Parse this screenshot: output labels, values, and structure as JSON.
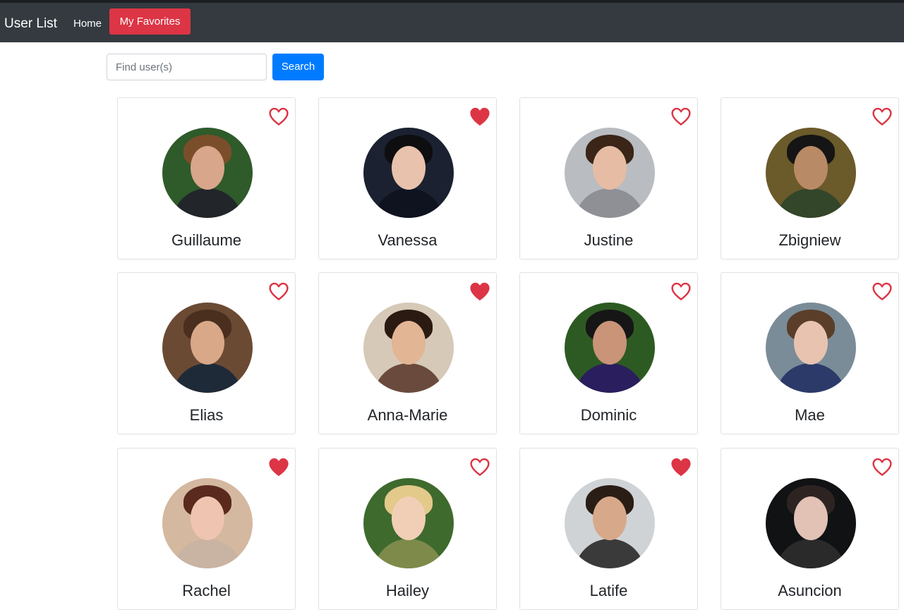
{
  "navbar": {
    "brand": "User List",
    "home_label": "Home",
    "favorites_label": "My Favorites"
  },
  "search": {
    "placeholder": "Find user(s)",
    "value": "",
    "button_label": "Search"
  },
  "colors": {
    "heart": "#dc3545",
    "primary": "#007bff",
    "navbar": "#343a40"
  },
  "users": [
    {
      "name": "Guillaume",
      "favorite": false
    },
    {
      "name": "Vanessa",
      "favorite": true
    },
    {
      "name": "Justine",
      "favorite": false
    },
    {
      "name": "Zbigniew",
      "favorite": false
    },
    {
      "name": "Elias",
      "favorite": false
    },
    {
      "name": "Anna-Marie",
      "favorite": true
    },
    {
      "name": "Dominic",
      "favorite": false
    },
    {
      "name": "Mae",
      "favorite": false
    },
    {
      "name": "Rachel",
      "favorite": true
    },
    {
      "name": "Hailey",
      "favorite": false
    },
    {
      "name": "Latife",
      "favorite": true
    },
    {
      "name": "Asuncion",
      "favorite": false
    }
  ]
}
